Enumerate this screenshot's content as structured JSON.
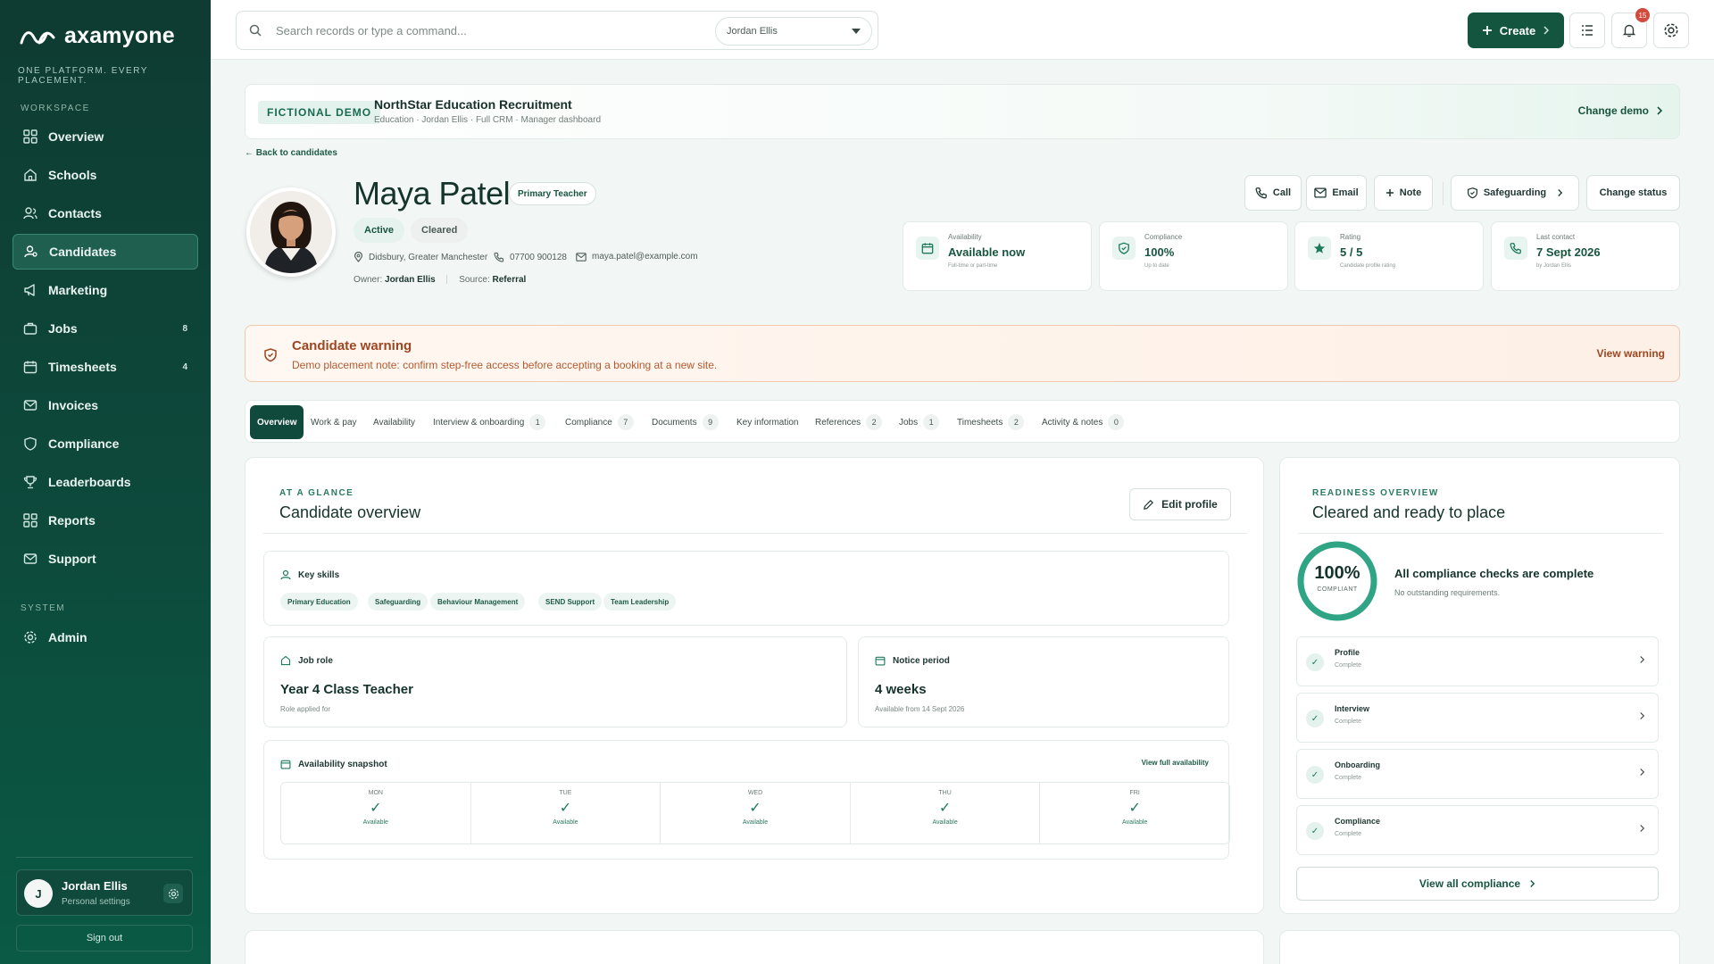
{
  "brand": {
    "name": "axamyone",
    "tagline": "ONE PLATFORM. EVERY PLACEMENT."
  },
  "sidebar": {
    "workspace_label": "WORKSPACE",
    "items": [
      {
        "label": "Overview",
        "icon": "grid-icon"
      },
      {
        "label": "Schools",
        "icon": "home-icon"
      },
      {
        "label": "Contacts",
        "icon": "users-icon"
      },
      {
        "label": "Candidates",
        "icon": "user-icon",
        "active": true
      },
      {
        "label": "Marketing",
        "icon": "megaphone-icon"
      },
      {
        "label": "Jobs",
        "icon": "briefcase-icon",
        "badge": "8"
      },
      {
        "label": "Timesheets",
        "icon": "calendar-icon",
        "badge": "4"
      },
      {
        "label": "Invoices",
        "icon": "mail-icon"
      },
      {
        "label": "Compliance",
        "icon": "shield-icon"
      },
      {
        "label": "Leaderboards",
        "icon": "trophy-icon"
      },
      {
        "label": "Reports",
        "icon": "grid-icon"
      },
      {
        "label": "Support",
        "icon": "mail-icon"
      }
    ],
    "system_label": "SYSTEM",
    "admin_label": "Admin",
    "user": {
      "initial": "J",
      "name": "Jordan Ellis",
      "sub": "Personal settings"
    },
    "signout": "Sign out"
  },
  "topbar": {
    "search_placeholder": "Search records or type a command...",
    "selected_user": "Jordan Ellis",
    "create_label": "Create",
    "notif_count": "15"
  },
  "demo": {
    "pill": "FICTIONAL DEMO",
    "title": "NorthStar Education Recruitment",
    "subtitle": "Education · Jordan Ellis · Full CRM · Manager dashboard",
    "change": "Change demo"
  },
  "candidate": {
    "back": "← Back to candidates",
    "name": "Maya Patel",
    "role_tag": "Primary Teacher",
    "status_active": "Active",
    "status_cleared": "Cleared",
    "location": "Didsbury, Greater Manchester",
    "phone": "07700 900128",
    "email": "maya.patel@example.com",
    "owner_label": "Owner:",
    "owner": "Jordan Ellis",
    "source_label": "Source:",
    "source": "Referral"
  },
  "actions": {
    "call": "Call",
    "email": "Email",
    "note": "Note",
    "safeguarding": "Safeguarding",
    "change_status": "Change status"
  },
  "stats": [
    {
      "label": "Availability",
      "value": "Available now",
      "sub": "Full-time or part-time"
    },
    {
      "label": "Compliance",
      "value": "100%",
      "sub": "Up to date"
    },
    {
      "label": "Rating",
      "value": "5 / 5",
      "sub": "Candidate profile rating"
    },
    {
      "label": "Last contact",
      "value": "7 Sept 2026",
      "sub": "by Jordan Ellis"
    }
  ],
  "warning": {
    "title": "Candidate warning",
    "desc": "Demo placement note: confirm step-free access before accepting a booking at a new site.",
    "view": "View warning"
  },
  "tabs": [
    {
      "label": "Overview"
    },
    {
      "label": "Work & pay"
    },
    {
      "label": "Availability"
    },
    {
      "label": "Interview & onboarding",
      "count": "1"
    },
    {
      "label": "Compliance",
      "count": "7"
    },
    {
      "label": "Documents",
      "count": "9"
    },
    {
      "label": "Key information"
    },
    {
      "label": "References",
      "count": "2"
    },
    {
      "label": "Jobs",
      "count": "1"
    },
    {
      "label": "Timesheets",
      "count": "2"
    },
    {
      "label": "Activity & notes",
      "count": "0"
    }
  ],
  "overview": {
    "eyebrow": "AT A GLANCE",
    "title": "Candidate overview",
    "edit": "Edit profile",
    "skills_title": "Key skills",
    "skills": [
      "Primary Education",
      "Safeguarding",
      "Behaviour Management",
      "SEND Support",
      "Team Leadership"
    ],
    "job_role_title": "Job role",
    "job_role": "Year 4 Class Teacher",
    "job_role_sub": "Role applied for",
    "notice_title": "Notice period",
    "notice": "4 weeks",
    "notice_sub": "Available from 14 Sept 2026",
    "avail_title": "Availability snapshot",
    "avail_link": "View full availability",
    "days": [
      {
        "day": "MON",
        "status": "Available"
      },
      {
        "day": "TUE",
        "status": "Available"
      },
      {
        "day": "WED",
        "status": "Available"
      },
      {
        "day": "THU",
        "status": "Available"
      },
      {
        "day": "FRI",
        "status": "Available"
      }
    ]
  },
  "readiness": {
    "eyebrow": "READINESS OVERVIEW",
    "title": "Cleared and ready to place",
    "pct": "100%",
    "pct_label": "COMPLIANT",
    "pct_value": 1.0,
    "all_complete": "All compliance checks are complete",
    "no_outstanding": "No outstanding requirements.",
    "checks": [
      {
        "title": "Profile",
        "status": "Complete"
      },
      {
        "title": "Interview",
        "status": "Complete"
      },
      {
        "title": "Onboarding",
        "status": "Complete"
      },
      {
        "title": "Compliance",
        "status": "Complete"
      }
    ],
    "view_all": "View all compliance"
  },
  "colors": {
    "brand_dark": "#0e3b32",
    "accent": "#13553f",
    "warning": "#9d4722"
  }
}
